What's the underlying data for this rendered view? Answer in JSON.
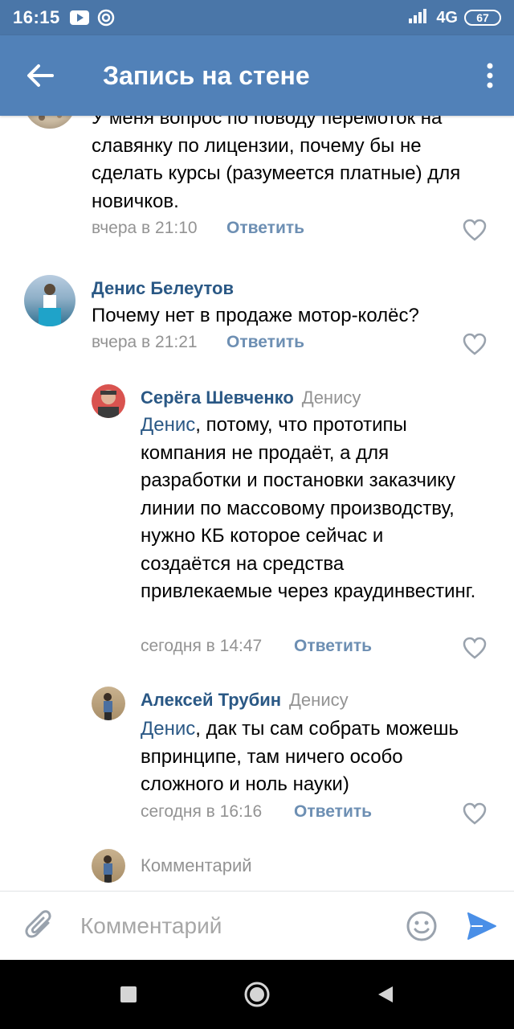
{
  "status_bar": {
    "time": "16:15",
    "network": "4G",
    "battery": "67",
    "icons": [
      "youtube-icon",
      "app-icon",
      "signal-icon",
      "battery-icon"
    ]
  },
  "header": {
    "title": "Запись на стене",
    "back_icon": "arrow-left-icon",
    "menu_icon": "more-vertical-icon",
    "color": "#5181b8"
  },
  "comments": [
    {
      "author": "",
      "text": "У меня вопрос по поводу перемоток на славянку по лицензии, почему бы не сделать курсы (разумеется платные) для новичков.",
      "time": "вчера в 21:10",
      "reply_label": "Ответить"
    },
    {
      "author": "Денис Белеутов",
      "text": "Почему нет в продаже мотор-колёс?",
      "time": "вчера в 21:21",
      "reply_label": "Ответить"
    },
    {
      "author": "Серёга Шевченко",
      "reply_to": "Денису",
      "mention": "Денис",
      "text": ", потому, что прототипы компания не продаёт, а для разработки и постановки заказчику линии по массовому производству, нужно КБ которое сейчас и создаётся на средства привлекаемые через краудинвестинг.",
      "time": "сегодня в 14:47",
      "reply_label": "Ответить"
    },
    {
      "author": "Алексей Трубин",
      "reply_to": "Денису",
      "mention": "Денис",
      "text": ", дак ты сам собрать можешь впринципе, там ничего особо сложного и ноль науки)",
      "time": "сегодня в 16:16",
      "reply_label": "Ответить"
    }
  ],
  "inline_comment": {
    "placeholder": "Комментарий"
  },
  "composer": {
    "placeholder": "Комментарий",
    "attach_icon": "paperclip-icon",
    "emoji_icon": "smile-icon",
    "send_icon": "send-icon"
  },
  "colors": {
    "link": "#2a5885",
    "meta": "#939393",
    "reply": "#6d8fb3",
    "accent": "#4a8fe7"
  }
}
